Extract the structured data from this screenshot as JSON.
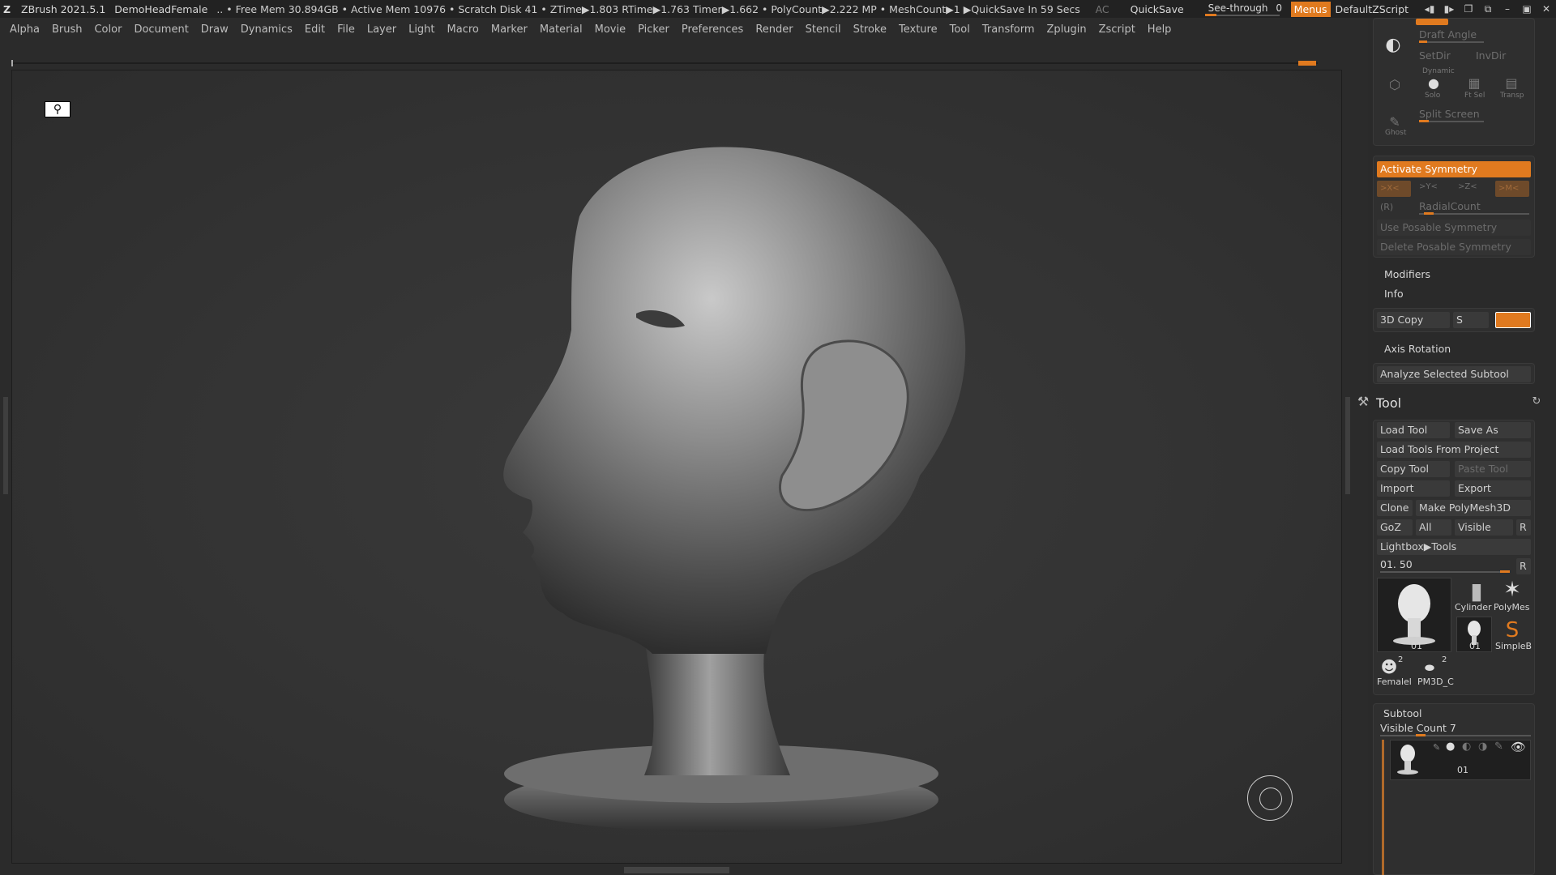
{
  "titlebar": {
    "app": "ZBrush 2021.5.1",
    "document": "DemoHeadFemale",
    "status": ".. • Free Mem 30.894GB • Active Mem 10976 • Scratch Disk 41 • ZTime▶1.803 RTime▶1.763 Timer▶1.662 • PolyCount▶2.222 MP • MeshCount▶1 ▶QuickSave In 59 Secs",
    "ac": "AC",
    "quicksave": "QuickSave",
    "see_through_label": "See-through",
    "see_through_value": "0",
    "menus": "Menus",
    "script": "DefaultZScript"
  },
  "menubar": [
    "Alpha",
    "Brush",
    "Color",
    "Document",
    "Draw",
    "Dynamics",
    "Edit",
    "File",
    "Layer",
    "Light",
    "Macro",
    "Marker",
    "Material",
    "Movie",
    "Picker",
    "Preferences",
    "Render",
    "Stencil",
    "Stroke",
    "Texture",
    "Tool",
    "Transform",
    "Zplugin",
    "Zscript",
    "Help"
  ],
  "transform_panel": {
    "draft_angle": "Draft Angle",
    "setdir": "SetDir",
    "invdir": "InvDir",
    "dynamic": "Dynamic",
    "solo": "Solo",
    "ft_sel": "Ft Sel",
    "transp": "Transp",
    "ghost": "Ghost",
    "split_screen": "Split Screen",
    "activate_symmetry": "Activate Symmetry",
    "sym_x": ">X<",
    "sym_y": ">Y<",
    "sym_z": ">Z<",
    "sym_m": ">M<",
    "sym_r": "(R)",
    "radial_count": "RadialCount",
    "use_posable": "Use Posable Symmetry",
    "delete_posable": "Delete Posable Symmetry",
    "modifiers": "Modifiers",
    "info": "Info",
    "copy3d": "3D Copy",
    "copy3d_s": "S",
    "axis_rotation": "Axis Rotation",
    "analyze": "Analyze Selected Subtool"
  },
  "tool_panel": {
    "title": "Tool",
    "load_tool": "Load Tool",
    "save_as": "Save As",
    "load_from_project": "Load Tools From Project",
    "copy_tool": "Copy Tool",
    "paste_tool": "Paste Tool",
    "import": "Import",
    "export": "Export",
    "clone": "Clone",
    "make_polymesh": "Make PolyMesh3D",
    "goz": "GoZ",
    "all": "All",
    "visible": "Visible",
    "r": "R",
    "lightbox_tools": "Lightbox▶Tools",
    "tool_slider_value": "01. 50",
    "slider_r": "R",
    "thumbs": {
      "main_label": "01",
      "cylinder": "Cylinder",
      "polymesh": "PolyMes",
      "small_head_label": "01",
      "simpleb": "SimpleB",
      "female_count": "2",
      "female": "Femalel",
      "pm3d_count": "2",
      "pm3d": "PM3D_C"
    }
  },
  "subtool_panel": {
    "title": "Subtool",
    "visible_count": "Visible Count 7",
    "item_label": "01"
  }
}
